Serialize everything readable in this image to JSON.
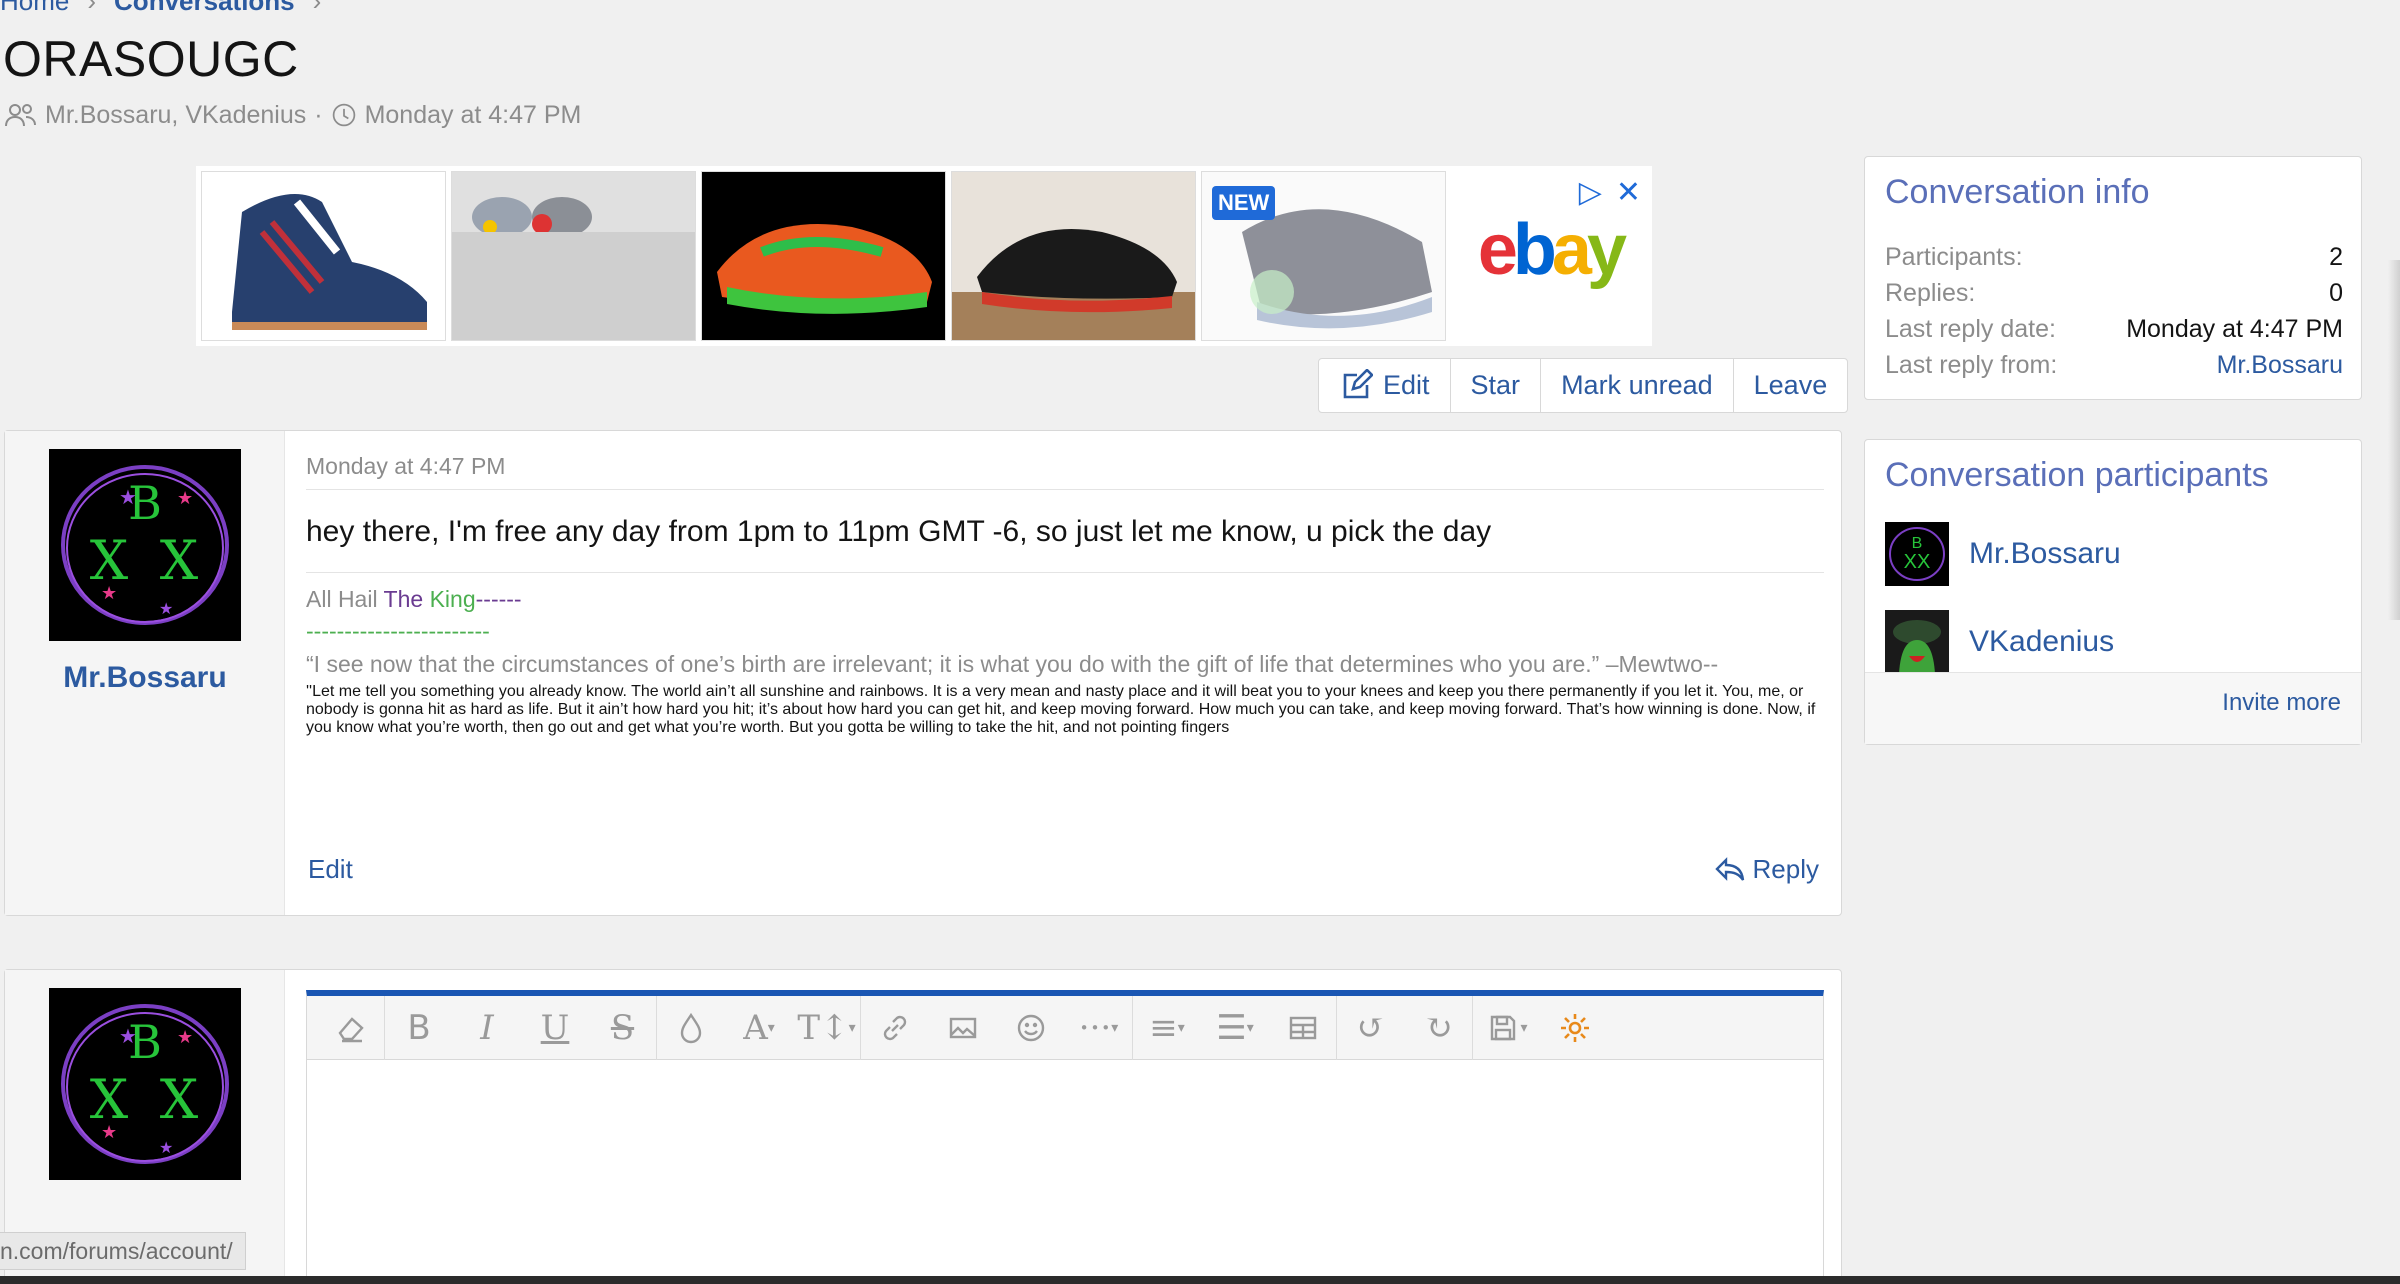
{
  "breadcrumb": {
    "home": "Home",
    "sep": "›",
    "current": "Conversations",
    "sep2": "›"
  },
  "page": {
    "title": "ORASOUGC"
  },
  "meta": {
    "participants": "Mr.Bossaru, VKadenius",
    "dot": "·",
    "date": "Monday at 4:47 PM"
  },
  "ad": {
    "new_badge": "NEW",
    "brand": "ebay"
  },
  "actions": {
    "edit": "Edit",
    "star": "Star",
    "mark_unread": "Mark unread",
    "leave": "Leave"
  },
  "message": {
    "author": "Mr.Bossaru",
    "date": "Monday at 4:47 PM",
    "body": "hey there, I'm free any day from 1pm to 11pm GMT -6, so just let me know, u pick the day",
    "sig_all_hail": "All Hail ",
    "sig_the": "The ",
    "sig_king": "King",
    "sig_dashes": "------",
    "sig_line": "------------------------",
    "sig_quote1": "“I see now that the circumstances of one’s birth are irrelevant; it is what you do with the gift of life that determines who you are.” –Mewtwo--",
    "sig_quote2": "''Let me tell you something you already know. The world ain’t all sunshine and rainbows. It is a very mean and nasty place and it will beat you to your knees and keep you there permanently if you let it. You, me, or nobody is gonna hit as hard as life. But it ain’t how hard you hit; it’s about how hard you can get hit, and keep moving forward. How much you can take, and keep moving forward. That’s how winning is done. Now, if you know what you’re worth, then go out and get what you’re worth. But you gotta be willing to take the hit, and not pointing fingers",
    "edit": "Edit",
    "reply": "Reply"
  },
  "sidebar": {
    "info_title": "Conversation info",
    "participants_label": "Participants:",
    "participants_value": "2",
    "replies_label": "Replies:",
    "replies_value": "0",
    "last_date_label": "Last reply date:",
    "last_date_value": "Monday at 4:47 PM",
    "last_from_label": "Last reply from:",
    "last_from_value": "Mr.Bossaru",
    "participants_title": "Conversation participants",
    "participant1": "Mr.Bossaru",
    "participant2": "VKadenius",
    "invite": "Invite more"
  },
  "status": {
    "url": "n.com/forums/account/"
  },
  "colors": {
    "link": "#2c5aa0",
    "editor_accent": "#1a56b3",
    "sidebar_title": "#5a6fb8"
  }
}
